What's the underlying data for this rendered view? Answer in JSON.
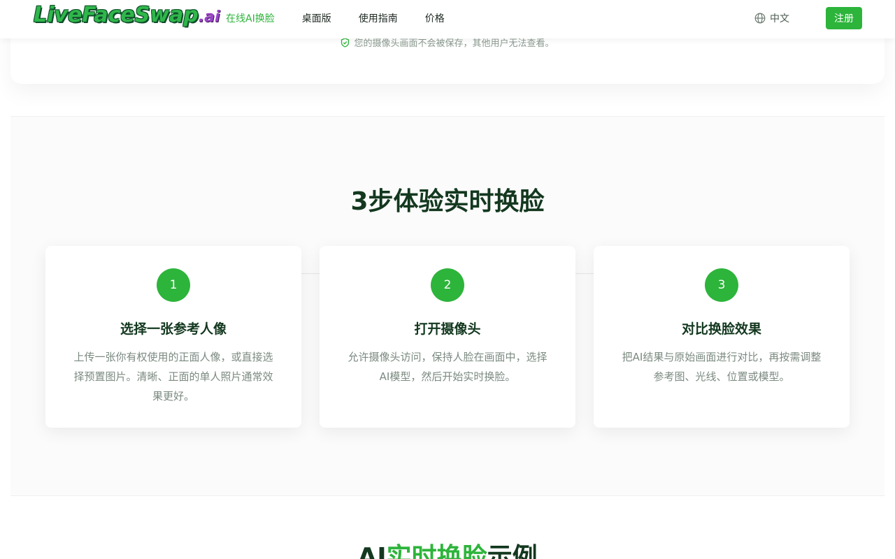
{
  "header": {
    "logo_main": "LiveFaceSwap",
    "logo_suffix": ".ai",
    "nav": [
      {
        "label": "在线AI换脸"
      },
      {
        "label": "桌面版"
      },
      {
        "label": "使用指南"
      },
      {
        "label": "价格"
      }
    ],
    "language": "中文",
    "signup_label": "注册"
  },
  "privacy_note": "您的摄像头画面不会被保存，其他用户无法查看。",
  "steps": {
    "title": "3步体验实时换脸",
    "cards": [
      {
        "number": "1",
        "title": "选择一张参考人像",
        "desc": "上传一张你有权使用的正面人像，或直接选择预置图片。清晰、正面的单人照片通常效果更好。"
      },
      {
        "number": "2",
        "title": "打开摄像头",
        "desc": "允许摄像头访问，保持人脸在画面中，选择AI模型，然后开始实时换脸。"
      },
      {
        "number": "3",
        "title": "对比换脸效果",
        "desc": "把AI结果与原始画面进行对比，再按需调整参考图、光线、位置或模型。"
      }
    ]
  },
  "examples": {
    "title_prefix": "AI",
    "title_highlight": "实时换脸",
    "title_suffix": "示例"
  },
  "colors": {
    "accent": "#2db43b",
    "heading": "#13381f"
  }
}
